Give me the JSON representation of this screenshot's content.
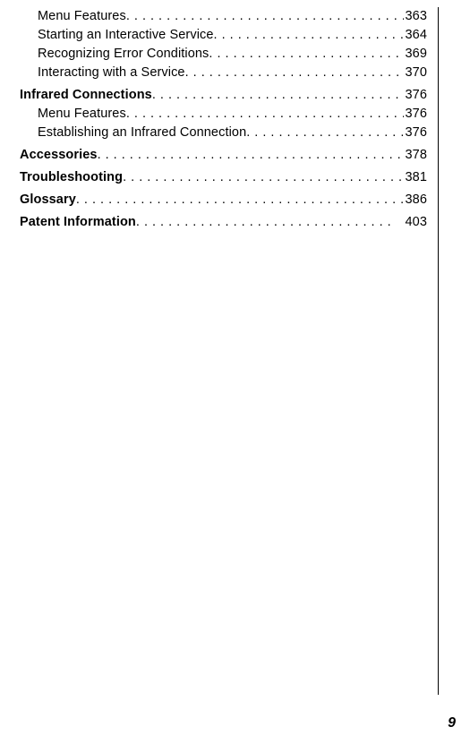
{
  "toc": [
    {
      "label": "Menu Features",
      "page": "363",
      "bold": false,
      "sub": true,
      "top": false,
      "pad": false
    },
    {
      "label": "Starting an Interactive Service",
      "page": "364",
      "bold": false,
      "sub": true,
      "top": false,
      "pad": false
    },
    {
      "label": "Recognizing Error Conditions",
      "page": "369",
      "bold": false,
      "sub": true,
      "top": false,
      "pad": false
    },
    {
      "label": "Interacting with a Service",
      "page": "370",
      "bold": false,
      "sub": true,
      "top": false,
      "pad": false
    },
    {
      "label": "Infrared Connections",
      "page": "376",
      "bold": true,
      "sub": false,
      "top": true,
      "pad": false
    },
    {
      "label": "Menu Features",
      "page": "376",
      "bold": false,
      "sub": true,
      "top": false,
      "pad": false
    },
    {
      "label": "Establishing an Infrared Connection",
      "page": "376",
      "bold": false,
      "sub": true,
      "top": false,
      "pad": false
    },
    {
      "label": "Accessories",
      "page": "378",
      "bold": true,
      "sub": false,
      "top": true,
      "pad": false
    },
    {
      "label": "Troubleshooting",
      "page": "381",
      "bold": true,
      "sub": false,
      "top": true,
      "pad": false
    },
    {
      "label": "Glossary",
      "page": "386",
      "bold": true,
      "sub": false,
      "top": true,
      "pad": false
    },
    {
      "label": "Patent Information",
      "page": "403",
      "bold": true,
      "sub": false,
      "top": true,
      "pad": true
    }
  ],
  "page_number": "9"
}
